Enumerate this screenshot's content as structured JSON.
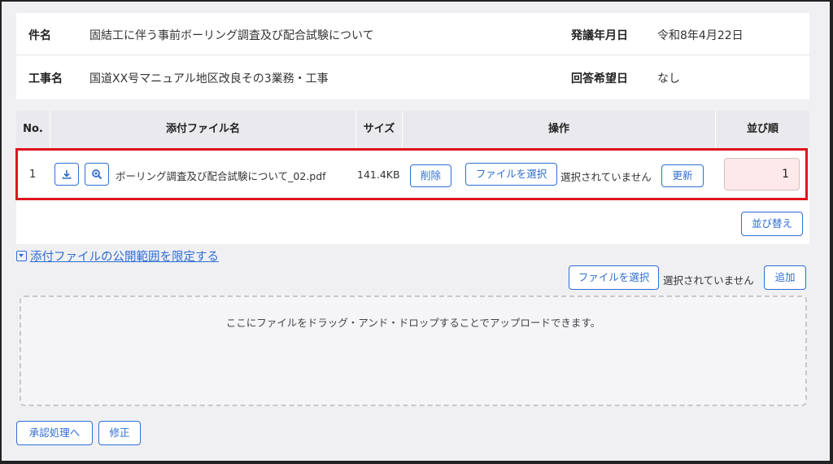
{
  "info": {
    "subject_label": "件名",
    "subject_value": "固結工に伴う事前ボーリング調査及び配合試験について",
    "date_label": "発議年月日",
    "date_value": "令和8年4月22日",
    "project_label": "工事名",
    "project_value": "国道XX号マニュアル地区改良その3業務・工事",
    "reply_label": "回答希望日",
    "reply_value": "なし"
  },
  "table": {
    "headers": {
      "no": "No.",
      "name": "添付ファイル名",
      "size": "サイズ",
      "op": "操作",
      "order": "並び順"
    },
    "rows": [
      {
        "no": "1",
        "filename": "ボーリング調査及び配合試験について_02.pdf",
        "size": "141.4KB",
        "delete_label": "削除",
        "choose_label": "ファイルを選択",
        "status": "選択されていません",
        "update_label": "更新",
        "order": "1"
      }
    ],
    "sort_label": "並び替え"
  },
  "visibility_link": "添付ファイルの公開範囲を限定する",
  "upload": {
    "choose_label": "ファイルを選択",
    "status": "選択されていません",
    "add_label": "追加",
    "drop_text": "ここにファイルをドラッグ・アンド・ドロップすることでアップロードできます。"
  },
  "footer": {
    "approve_label": "承認処理へ",
    "edit_label": "修正"
  },
  "colors": {
    "accent": "#2f6ed3",
    "highlight": "#e0141e",
    "order_input_bg": "#fde9e9"
  }
}
